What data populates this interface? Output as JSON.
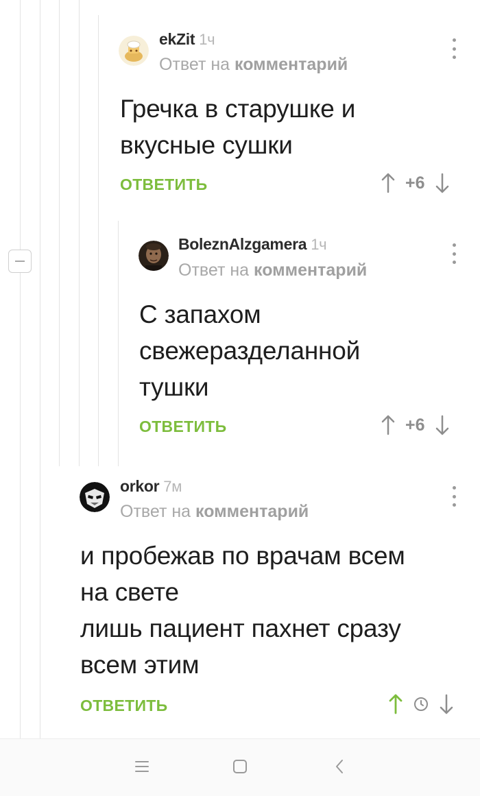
{
  "comments": [
    {
      "author": "ekZit",
      "time": "1ч",
      "reply_prefix": "Ответ на",
      "reply_target": "комментарий",
      "lines": [
        "Гречка в старушке и",
        "вкусные сушки"
      ],
      "reply_label": "ОТВЕТИТЬ",
      "score": "+6"
    },
    {
      "author": "BoleznAlzgamera",
      "time": "1ч",
      "reply_prefix": "Ответ на",
      "reply_target": "комментарий",
      "lines": [
        "С запахом",
        "свежеразделанной",
        "тушки"
      ],
      "reply_label": "ОТВЕТИТЬ",
      "score": "+6"
    },
    {
      "author": "orkor",
      "time": "7м",
      "reply_prefix": "Ответ на",
      "reply_target": "комментарий",
      "lines": [
        "и пробежав по врачам всем",
        "на свете",
        "лишь пациент пахнет сразу",
        "всем этим"
      ],
      "reply_label": "ОТВЕТИТЬ",
      "upvoted": true
    }
  ],
  "colors": {
    "accent_green": "#7dbd3d",
    "text_main": "#1e1e1e",
    "text_muted": "#a8a8a8"
  },
  "icons": {
    "nav": [
      "menu-icon",
      "home-square-icon",
      "back-chevron-icon"
    ],
    "comment": [
      "kebab-menu-icon",
      "arrow-up-icon",
      "arrow-down-icon",
      "clock-icon"
    ]
  }
}
